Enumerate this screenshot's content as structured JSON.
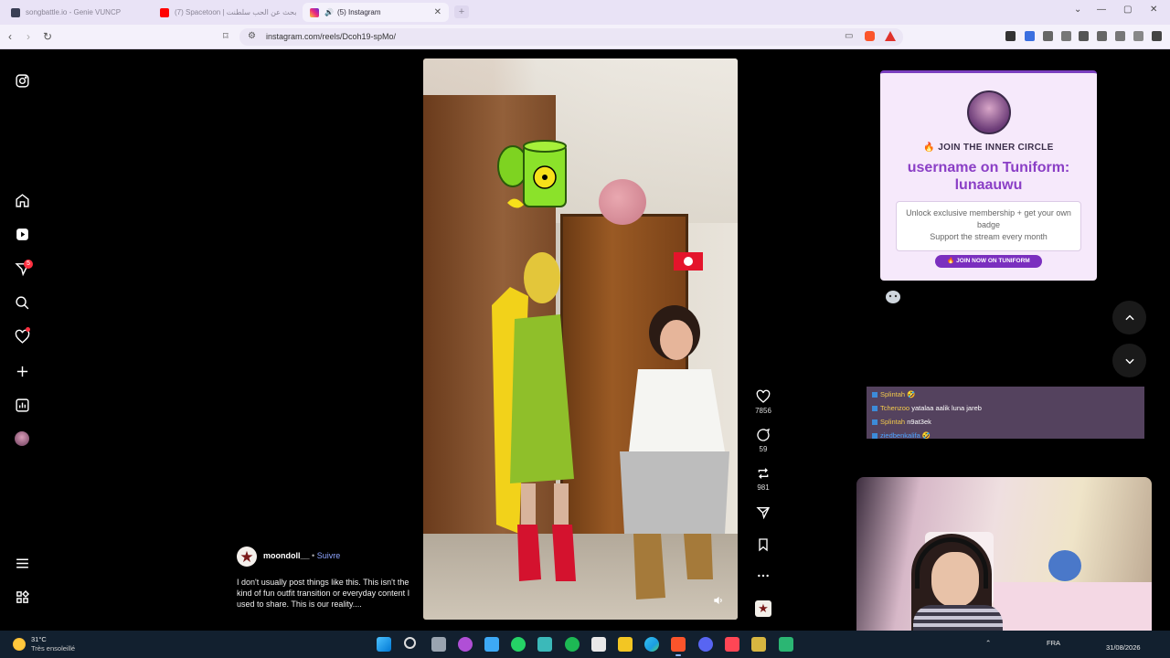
{
  "browser": {
    "tabs": [
      {
        "label": "songbattle.io - Genie VUNCP",
        "active": false
      },
      {
        "label": "(7) Spacetoon | ابحث عن الحب سلطنت",
        "active": false
      },
      {
        "label": "(5) Instagram",
        "active": true
      }
    ],
    "new_tab": "+",
    "url": "instagram.com/reels/Dcoh19-spMo/"
  },
  "reel": {
    "author": "moondoll__",
    "separator": "•",
    "follow_label": "Suivre",
    "caption": "I don't usually post things like this. This isn't the kind of fun outfit transition or everyday content I used to share. This is our reality....",
    "likes": "7856",
    "comments": "59",
    "reposts": "981"
  },
  "ig_nav": {
    "messages_badge": "5"
  },
  "overlay_card": {
    "join_line": "🔥 JOIN THE INNER CIRCLE",
    "headline": "username on Tuniform: lunaauwu",
    "description_line1": "Unlock exclusive membership + get your own badge",
    "description_line2": "Support the stream every month",
    "cta": "🔥 JOIN NOW ON TUNIFORM"
  },
  "chat": [
    {
      "user": "Splintah",
      "message": "🤣"
    },
    {
      "user": "Tchenzoo",
      "message": "yatalaa aalik luna jareb"
    },
    {
      "user": "Splintah",
      "message": "n9at3ek"
    },
    {
      "user": "ziedbenkalifa",
      "message": "🤣"
    }
  ],
  "taskbar": {
    "temperature": "31°C",
    "weather": "Très ensoleillé",
    "lang": "FRA",
    "date": "31/08/2026"
  },
  "colors": {
    "instagram_bg": "#000000",
    "follow_blue": "#8ea4ff",
    "card_purple": "#8b3fc6",
    "taskbar": "#12202f"
  }
}
